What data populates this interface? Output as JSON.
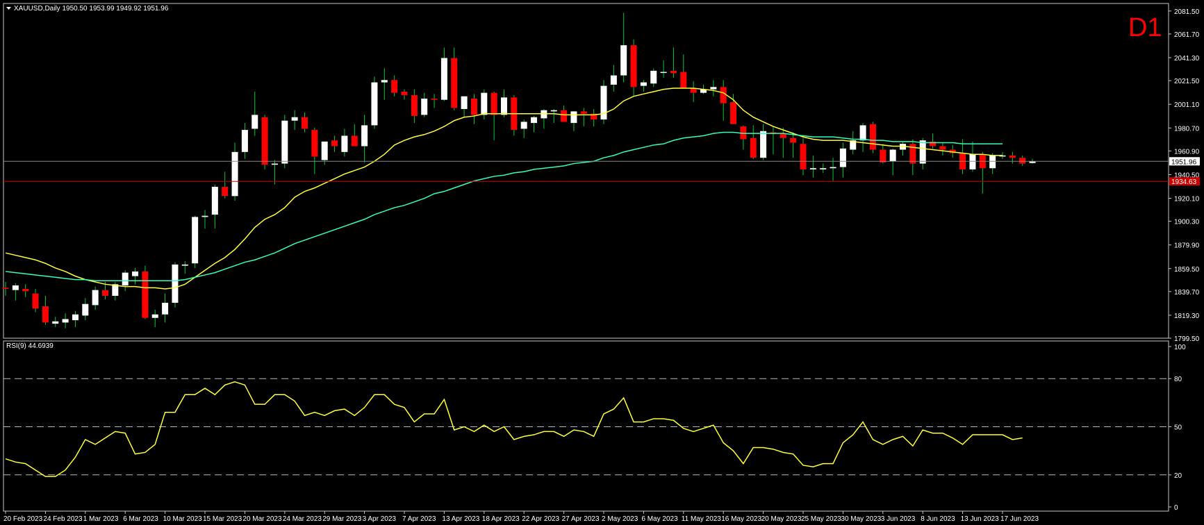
{
  "header": {
    "symbol_line": "XAUUSD,Daily  1950.50 1953.99 1949.92 1951.96",
    "timeframe": "D1"
  },
  "colors": {
    "background": "#000000",
    "frame": "#c8c8c8",
    "bull_body": "#ffffff",
    "bear_body": "#ff0000",
    "wick": "#00cc33",
    "ma_fast": "#ffff33",
    "ma_slow": "#33ffbb",
    "rsi": "#ffff33",
    "timeframe_label": "#ff0000",
    "price_line": "#888888",
    "level_line": "#cc0000"
  },
  "chart_data": [
    {
      "type": "candlestick",
      "title": "XAUUSD,Daily",
      "ylim": [
        1799.5,
        2088
      ],
      "y_ticks": [
        "2081.50",
        "2061.70",
        "2041.30",
        "2021.50",
        "2001.10",
        "1980.70",
        "1960.90",
        "1940.50",
        "1920.10",
        "1900.30",
        "1879.90",
        "1859.50",
        "1839.70",
        "1819.30",
        "1799.50"
      ],
      "x_ticks": [
        {
          "index": 0,
          "label": "20 Feb 2023"
        },
        {
          "index": 4,
          "label": "24 Feb 2023"
        },
        {
          "index": 8,
          "label": "1 Mar 2023"
        },
        {
          "index": 12,
          "label": "6 Mar 2023"
        },
        {
          "index": 16,
          "label": "10 Mar 2023"
        },
        {
          "index": 20,
          "label": "15 Mar 2023"
        },
        {
          "index": 24,
          "label": "20 Mar 2023"
        },
        {
          "index": 28,
          "label": "24 Mar 2023"
        },
        {
          "index": 32,
          "label": "29 Mar 2023"
        },
        {
          "index": 36,
          "label": "3 Apr 2023"
        },
        {
          "index": 40,
          "label": "7 Apr 2023"
        },
        {
          "index": 44,
          "label": "13 Apr 2023"
        },
        {
          "index": 48,
          "label": "18 Apr 2023"
        },
        {
          "index": 52,
          "label": "22 Apr 2023"
        },
        {
          "index": 56,
          "label": "27 Apr 2023"
        },
        {
          "index": 60,
          "label": "2 May 2023"
        },
        {
          "index": 64,
          "label": "6 May 2023"
        },
        {
          "index": 68,
          "label": "11 May 2023"
        },
        {
          "index": 72,
          "label": "16 May 2023"
        },
        {
          "index": 76,
          "label": "20 May 2023"
        },
        {
          "index": 80,
          "label": "25 May 2023"
        },
        {
          "index": 84,
          "label": "30 May 2023"
        },
        {
          "index": 88,
          "label": "3 Jun 2023"
        },
        {
          "index": 92,
          "label": "8 Jun 2023"
        },
        {
          "index": 96,
          "label": "13 Jun 2023"
        },
        {
          "index": 100,
          "label": "17 Jun 2023"
        }
      ],
      "ohlc": [
        [
          1843,
          1848,
          1836,
          1842
        ],
        [
          1841,
          1847,
          1832,
          1845
        ],
        [
          1842,
          1846,
          1835,
          1840
        ],
        [
          1838,
          1842,
          1822,
          1825
        ],
        [
          1827,
          1836,
          1811,
          1813
        ],
        [
          1812,
          1818,
          1809,
          1814
        ],
        [
          1813,
          1821,
          1808,
          1816
        ],
        [
          1815,
          1823,
          1809,
          1820
        ],
        [
          1819,
          1834,
          1815,
          1829
        ],
        [
          1828,
          1844,
          1824,
          1841
        ],
        [
          1841,
          1848,
          1833,
          1836
        ],
        [
          1836,
          1848,
          1832,
          1846
        ],
        [
          1845,
          1858,
          1840,
          1856
        ],
        [
          1853,
          1860,
          1846,
          1857
        ],
        [
          1857,
          1862,
          1816,
          1817
        ],
        [
          1817,
          1824,
          1809,
          1820
        ],
        [
          1820,
          1838,
          1813,
          1830
        ],
        [
          1830,
          1865,
          1826,
          1863
        ],
        [
          1862,
          1866,
          1855,
          1863
        ],
        [
          1864,
          1905,
          1860,
          1904
        ],
        [
          1904,
          1910,
          1894,
          1905
        ],
        [
          1906,
          1932,
          1894,
          1930
        ],
        [
          1930,
          1943,
          1920,
          1922
        ],
        [
          1922,
          1968,
          1918,
          1960
        ],
        [
          1960,
          1985,
          1954,
          1979
        ],
        [
          1980,
          2012,
          1974,
          1992
        ],
        [
          1990,
          1992,
          1945,
          1949
        ],
        [
          1949,
          1953,
          1932,
          1950
        ],
        [
          1950,
          1992,
          1946,
          1987
        ],
        [
          1987,
          1996,
          1979,
          1990
        ],
        [
          1990,
          1994,
          1977,
          1980
        ],
        [
          1979,
          1981,
          1941,
          1956
        ],
        [
          1953,
          1966,
          1949,
          1969
        ],
        [
          1970,
          1974,
          1960,
          1965
        ],
        [
          1960,
          1980,
          1956,
          1974
        ],
        [
          1974,
          1984,
          1966,
          1965
        ],
        [
          1965,
          1992,
          1951,
          1983
        ],
        [
          1983,
          2025,
          1980,
          2020
        ],
        [
          2020,
          2032,
          2005,
          2022
        ],
        [
          2022,
          2026,
          2008,
          2011
        ],
        [
          2012,
          2014,
          2005,
          2009
        ],
        [
          2009,
          2014,
          1985,
          1991
        ],
        [
          1992,
          2011,
          1990,
          2006
        ],
        [
          2006,
          2010,
          1998,
          2005
        ],
        [
          2005,
          2050,
          2004,
          2041
        ],
        [
          2041,
          2050,
          1996,
          1998
        ],
        [
          1997,
          2008,
          1990,
          2008
        ],
        [
          2006,
          2010,
          1984,
          1992
        ],
        [
          1992,
          2014,
          1988,
          2011
        ],
        [
          2011,
          2012,
          1970,
          1992
        ],
        [
          1992,
          2014,
          1990,
          2007
        ],
        [
          2007,
          2009,
          1974,
          1979
        ],
        [
          1980,
          1988,
          1972,
          1986
        ],
        [
          1985,
          1991,
          1977,
          1990
        ],
        [
          1989,
          1997,
          1980,
          1996
        ],
        [
          1995,
          1997,
          1985,
          1996
        ],
        [
          1996,
          2000,
          1986,
          1986
        ],
        [
          1985,
          1995,
          1978,
          1995
        ],
        [
          1995,
          1998,
          1982,
          1993
        ],
        [
          1993,
          1997,
          1982,
          1988
        ],
        [
          1988,
          2022,
          1984,
          2017
        ],
        [
          2018,
          2035,
          2012,
          2026
        ],
        [
          2026,
          2080,
          2020,
          2052
        ],
        [
          2052,
          2057,
          2008,
          2016
        ],
        [
          2017,
          2022,
          2012,
          2020
        ],
        [
          2019,
          2032,
          2016,
          2030
        ],
        [
          2029,
          2039,
          2024,
          2029
        ],
        [
          2030,
          2050,
          2024,
          2028
        ],
        [
          2029,
          2044,
          2019,
          2015
        ],
        [
          2015,
          2021,
          2003,
          2011
        ],
        [
          2011,
          2018,
          2010,
          2014
        ],
        [
          2014,
          2022,
          2008,
          2016
        ],
        [
          2016,
          2022,
          1987,
          2002
        ],
        [
          2003,
          2010,
          1985,
          1984
        ],
        [
          1982,
          1983,
          1962,
          1971
        ],
        [
          1972,
          1983,
          1954,
          1955
        ],
        [
          1955,
          1984,
          1953,
          1978
        ],
        [
          1977,
          1982,
          1958,
          1976
        ],
        [
          1976,
          1981,
          1955,
          1972
        ],
        [
          1972,
          1977,
          1955,
          1968
        ],
        [
          1967,
          1972,
          1940,
          1945
        ],
        [
          1945,
          1957,
          1938,
          1946
        ],
        [
          1945,
          1950,
          1942,
          1946
        ],
        [
          1946,
          1955,
          1935,
          1947
        ],
        [
          1947,
          1968,
          1938,
          1963
        ],
        [
          1962,
          1978,
          1958,
          1970
        ],
        [
          1970,
          1985,
          1960,
          1983
        ],
        [
          1984,
          1986,
          1959,
          1962
        ],
        [
          1962,
          1967,
          1950,
          1951
        ],
        [
          1952,
          1963,
          1940,
          1962
        ],
        [
          1962,
          1969,
          1957,
          1967
        ],
        [
          1967,
          1971,
          1940,
          1950
        ],
        [
          1950,
          1972,
          1945,
          1970
        ],
        [
          1969,
          1976,
          1963,
          1965
        ],
        [
          1965,
          1968,
          1957,
          1962
        ],
        [
          1962,
          1966,
          1955,
          1959
        ],
        [
          1959,
          1971,
          1941,
          1945
        ],
        [
          1945,
          1969,
          1943,
          1958
        ],
        [
          1958,
          1960,
          1924,
          1946
        ],
        [
          1946,
          1959,
          1941,
          1957
        ],
        [
          1957,
          1960,
          1954,
          1957
        ],
        [
          1957,
          1960,
          1950,
          1955
        ],
        [
          1955,
          1957,
          1948,
          1950
        ],
        [
          1950.5,
          1953.99,
          1949.92,
          1951.96
        ]
      ],
      "series": [
        {
          "name": "MA fast",
          "values": [
            1873,
            1871,
            1869,
            1867,
            1864,
            1860,
            1857,
            1853,
            1850,
            1848,
            1846,
            1845,
            1844,
            1844,
            1843,
            1843,
            1842,
            1843,
            1846,
            1852,
            1858,
            1864,
            1869,
            1876,
            1885,
            1895,
            1902,
            1906,
            1912,
            1921,
            1926,
            1929,
            1933,
            1937,
            1941,
            1944,
            1947,
            1952,
            1958,
            1966,
            1970,
            1973,
            1975,
            1978,
            1982,
            1987,
            1990,
            1991,
            1993,
            1993,
            1993,
            1993,
            1993,
            1993,
            1993,
            1993,
            1992,
            1992,
            1992,
            1992,
            1993,
            1997,
            2004,
            2008,
            2010,
            2012,
            2014,
            2015,
            2015,
            2015,
            2014,
            2013,
            2011,
            2005,
            1996,
            1990,
            1986,
            1982,
            1979,
            1976,
            1973,
            1971,
            1970,
            1970,
            1970,
            1969,
            1968,
            1967,
            1966,
            1965,
            1965,
            1964,
            1963,
            1962,
            1961,
            1960,
            1959,
            1958,
            1958,
            1957,
            1957
          ]
        },
        {
          "name": "MA slow",
          "values": [
            1857,
            1856,
            1855,
            1854,
            1853,
            1852,
            1851,
            1850,
            1850,
            1849,
            1849,
            1849,
            1849,
            1849,
            1849,
            1849,
            1849,
            1849,
            1850,
            1852,
            1854,
            1856,
            1859,
            1862,
            1865,
            1867,
            1870,
            1873,
            1877,
            1881,
            1884,
            1887,
            1890,
            1893,
            1896,
            1899,
            1902,
            1906,
            1909,
            1912,
            1914,
            1917,
            1920,
            1924,
            1926,
            1929,
            1932,
            1935,
            1937,
            1939,
            1940,
            1942,
            1943,
            1945,
            1946,
            1947,
            1948,
            1950,
            1951,
            1952,
            1955,
            1957,
            1960,
            1962,
            1964,
            1966,
            1967,
            1970,
            1972,
            1973,
            1974,
            1976,
            1977,
            1977,
            1976,
            1976,
            1976,
            1976,
            1976,
            1975,
            1974,
            1973,
            1973,
            1973,
            1972,
            1971,
            1971,
            1970,
            1970,
            1969,
            1969,
            1969,
            1968,
            1968,
            1968,
            1968,
            1967,
            1967,
            1967,
            1967,
            1967
          ]
        }
      ],
      "horizontal_lines": [
        {
          "name": "current price",
          "value": 1951.96,
          "label": "1951.96"
        },
        {
          "name": "level",
          "value": 1934.63,
          "label": "1934.63"
        }
      ]
    },
    {
      "type": "line",
      "title": "RSI(9) 44.6939",
      "ylim": [
        0,
        100
      ],
      "y_ticks": [
        "100",
        "80",
        "50",
        "20",
        "0"
      ],
      "levels": [
        80,
        50,
        20
      ],
      "series": [
        {
          "name": "RSI(9)",
          "values": [
            30,
            28,
            27,
            23,
            19,
            19,
            23,
            31,
            42,
            39,
            43,
            47,
            46,
            33,
            34,
            39,
            59,
            59,
            70,
            70,
            74,
            70,
            76,
            78,
            76,
            64,
            64,
            70,
            70,
            66,
            57,
            59,
            57,
            60,
            61,
            57,
            62,
            70,
            70,
            64,
            62,
            53,
            58,
            58,
            67,
            48,
            50,
            47,
            51,
            47,
            50,
            42,
            44,
            45,
            47,
            47,
            44,
            48,
            47,
            44,
            58,
            61,
            68,
            53,
            53,
            55,
            55,
            54,
            49,
            47,
            49,
            51,
            40,
            35,
            27,
            37,
            37,
            36,
            34,
            33,
            26,
            25,
            27,
            27,
            40,
            45,
            53,
            42,
            39,
            42,
            44,
            38,
            48,
            46,
            46,
            43,
            39,
            45,
            45,
            45,
            45,
            42,
            43
          ]
        }
      ]
    }
  ]
}
